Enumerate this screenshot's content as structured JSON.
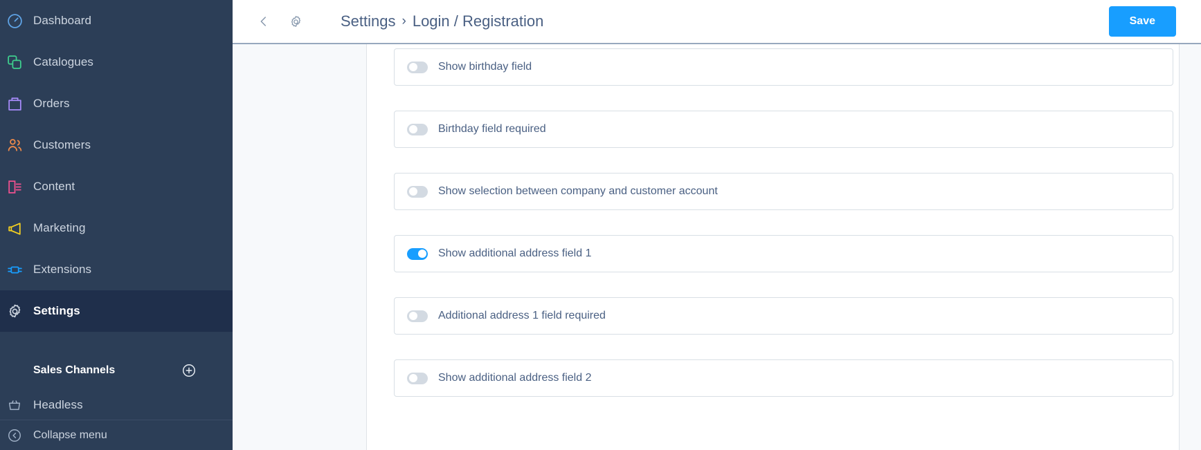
{
  "sidebar": {
    "items": [
      {
        "label": "Dashboard",
        "icon": "dashboard-icon",
        "color": "#60a5e8",
        "active": false
      },
      {
        "label": "Catalogues",
        "icon": "catalogues-icon",
        "color": "#3ecf8e",
        "active": false
      },
      {
        "label": "Orders",
        "icon": "orders-icon",
        "color": "#a78bfa",
        "active": false
      },
      {
        "label": "Customers",
        "icon": "customers-icon",
        "color": "#f08b4a",
        "active": false
      },
      {
        "label": "Content",
        "icon": "content-icon",
        "color": "#f0518f",
        "active": false
      },
      {
        "label": "Marketing",
        "icon": "marketing-icon",
        "color": "#f5d020",
        "active": false
      },
      {
        "label": "Extensions",
        "icon": "extensions-icon",
        "color": "#189eff",
        "active": false
      },
      {
        "label": "Settings",
        "icon": "gear-icon",
        "color": "#cdd5e0",
        "active": true
      }
    ],
    "sales_channels": {
      "title": "Sales Channels",
      "add_icon": "plus-circle-icon",
      "channels": [
        {
          "label": "Headless",
          "icon": "headless-icon"
        }
      ]
    },
    "collapse": {
      "label": "Collapse menu",
      "icon": "chevron-left-circle-icon"
    }
  },
  "topbar": {
    "back_icon": "chevron-left-icon",
    "settings_icon": "gear-icon",
    "breadcrumb": {
      "root": "Settings",
      "separator": "›",
      "current": "Login / Registration"
    },
    "save_label": "Save",
    "save_color": "#189eff"
  },
  "settings": {
    "rows": [
      {
        "label": "",
        "on": false,
        "partial": true
      },
      {
        "label": "Show birthday field",
        "on": false
      },
      {
        "label": "Birthday field required",
        "on": false
      },
      {
        "label": "Show selection between company and customer account",
        "on": false
      },
      {
        "label": "Show additional address field 1",
        "on": true
      },
      {
        "label": "Additional address 1 field required",
        "on": false
      },
      {
        "label": "Show additional address field 2",
        "on": false
      }
    ]
  }
}
